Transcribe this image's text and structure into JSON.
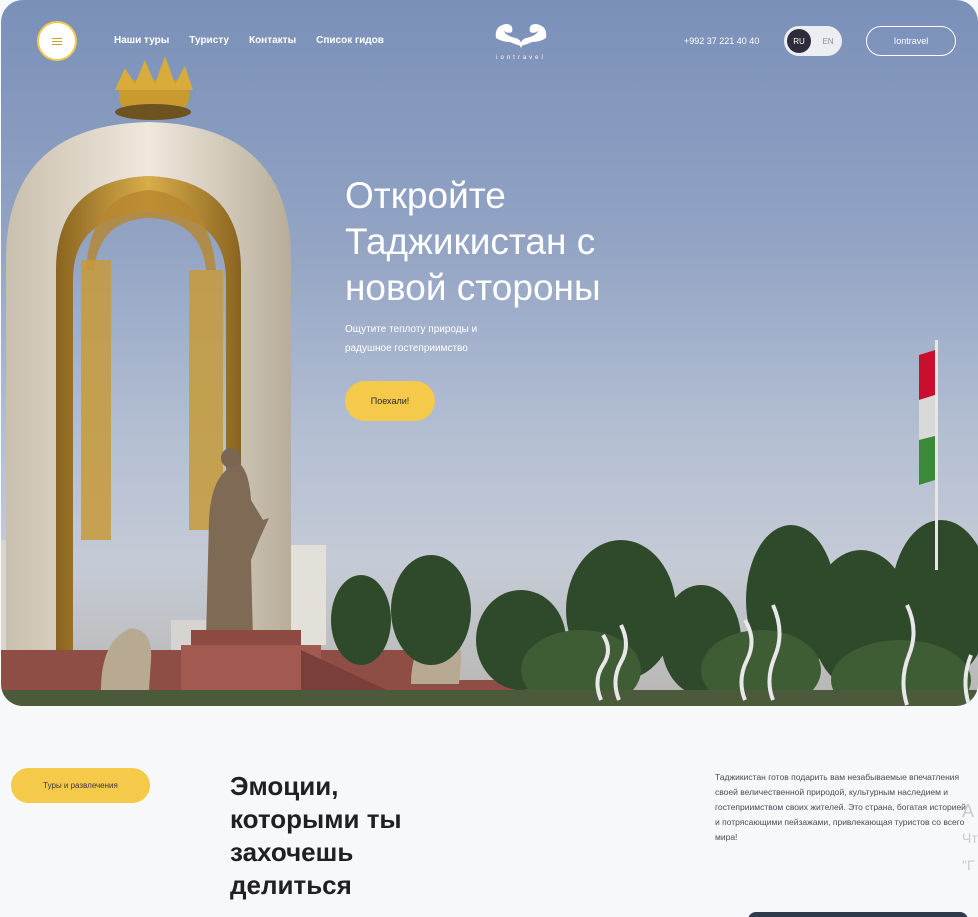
{
  "header": {
    "nav": [
      "Наши туры",
      "Туристу",
      "Контакты",
      "Список гидов"
    ],
    "logo_text": "iontravel",
    "phone": "+992 37 221 40 40",
    "languages": {
      "active": "RU",
      "inactive": "EN"
    },
    "login_label": "Iontravel"
  },
  "hero": {
    "title": "Откройте Таджикистан с новой стороны",
    "subtitle": "Ощутите теплоту природы и радушное гостеприимство",
    "cta_label": "Поехали!"
  },
  "section": {
    "tag_label": "Туры и развлечения",
    "title": "Эмоции, которыми ты захочешь делиться",
    "text": "Таджикистан готов подарить вам незабываемые впечатления своей величественной природой, культурным наследием и гостеприимством своих жителей. Это страна, богатая историей и потрясающими пейзажами, привлекающая туристов со всего мира!",
    "peek_lines": [
      "A",
      "Чт",
      "\"Г"
    ]
  },
  "colors": {
    "accent": "#f5c94a",
    "dark": "#2e2c3a",
    "background": "#f7f8fa"
  }
}
